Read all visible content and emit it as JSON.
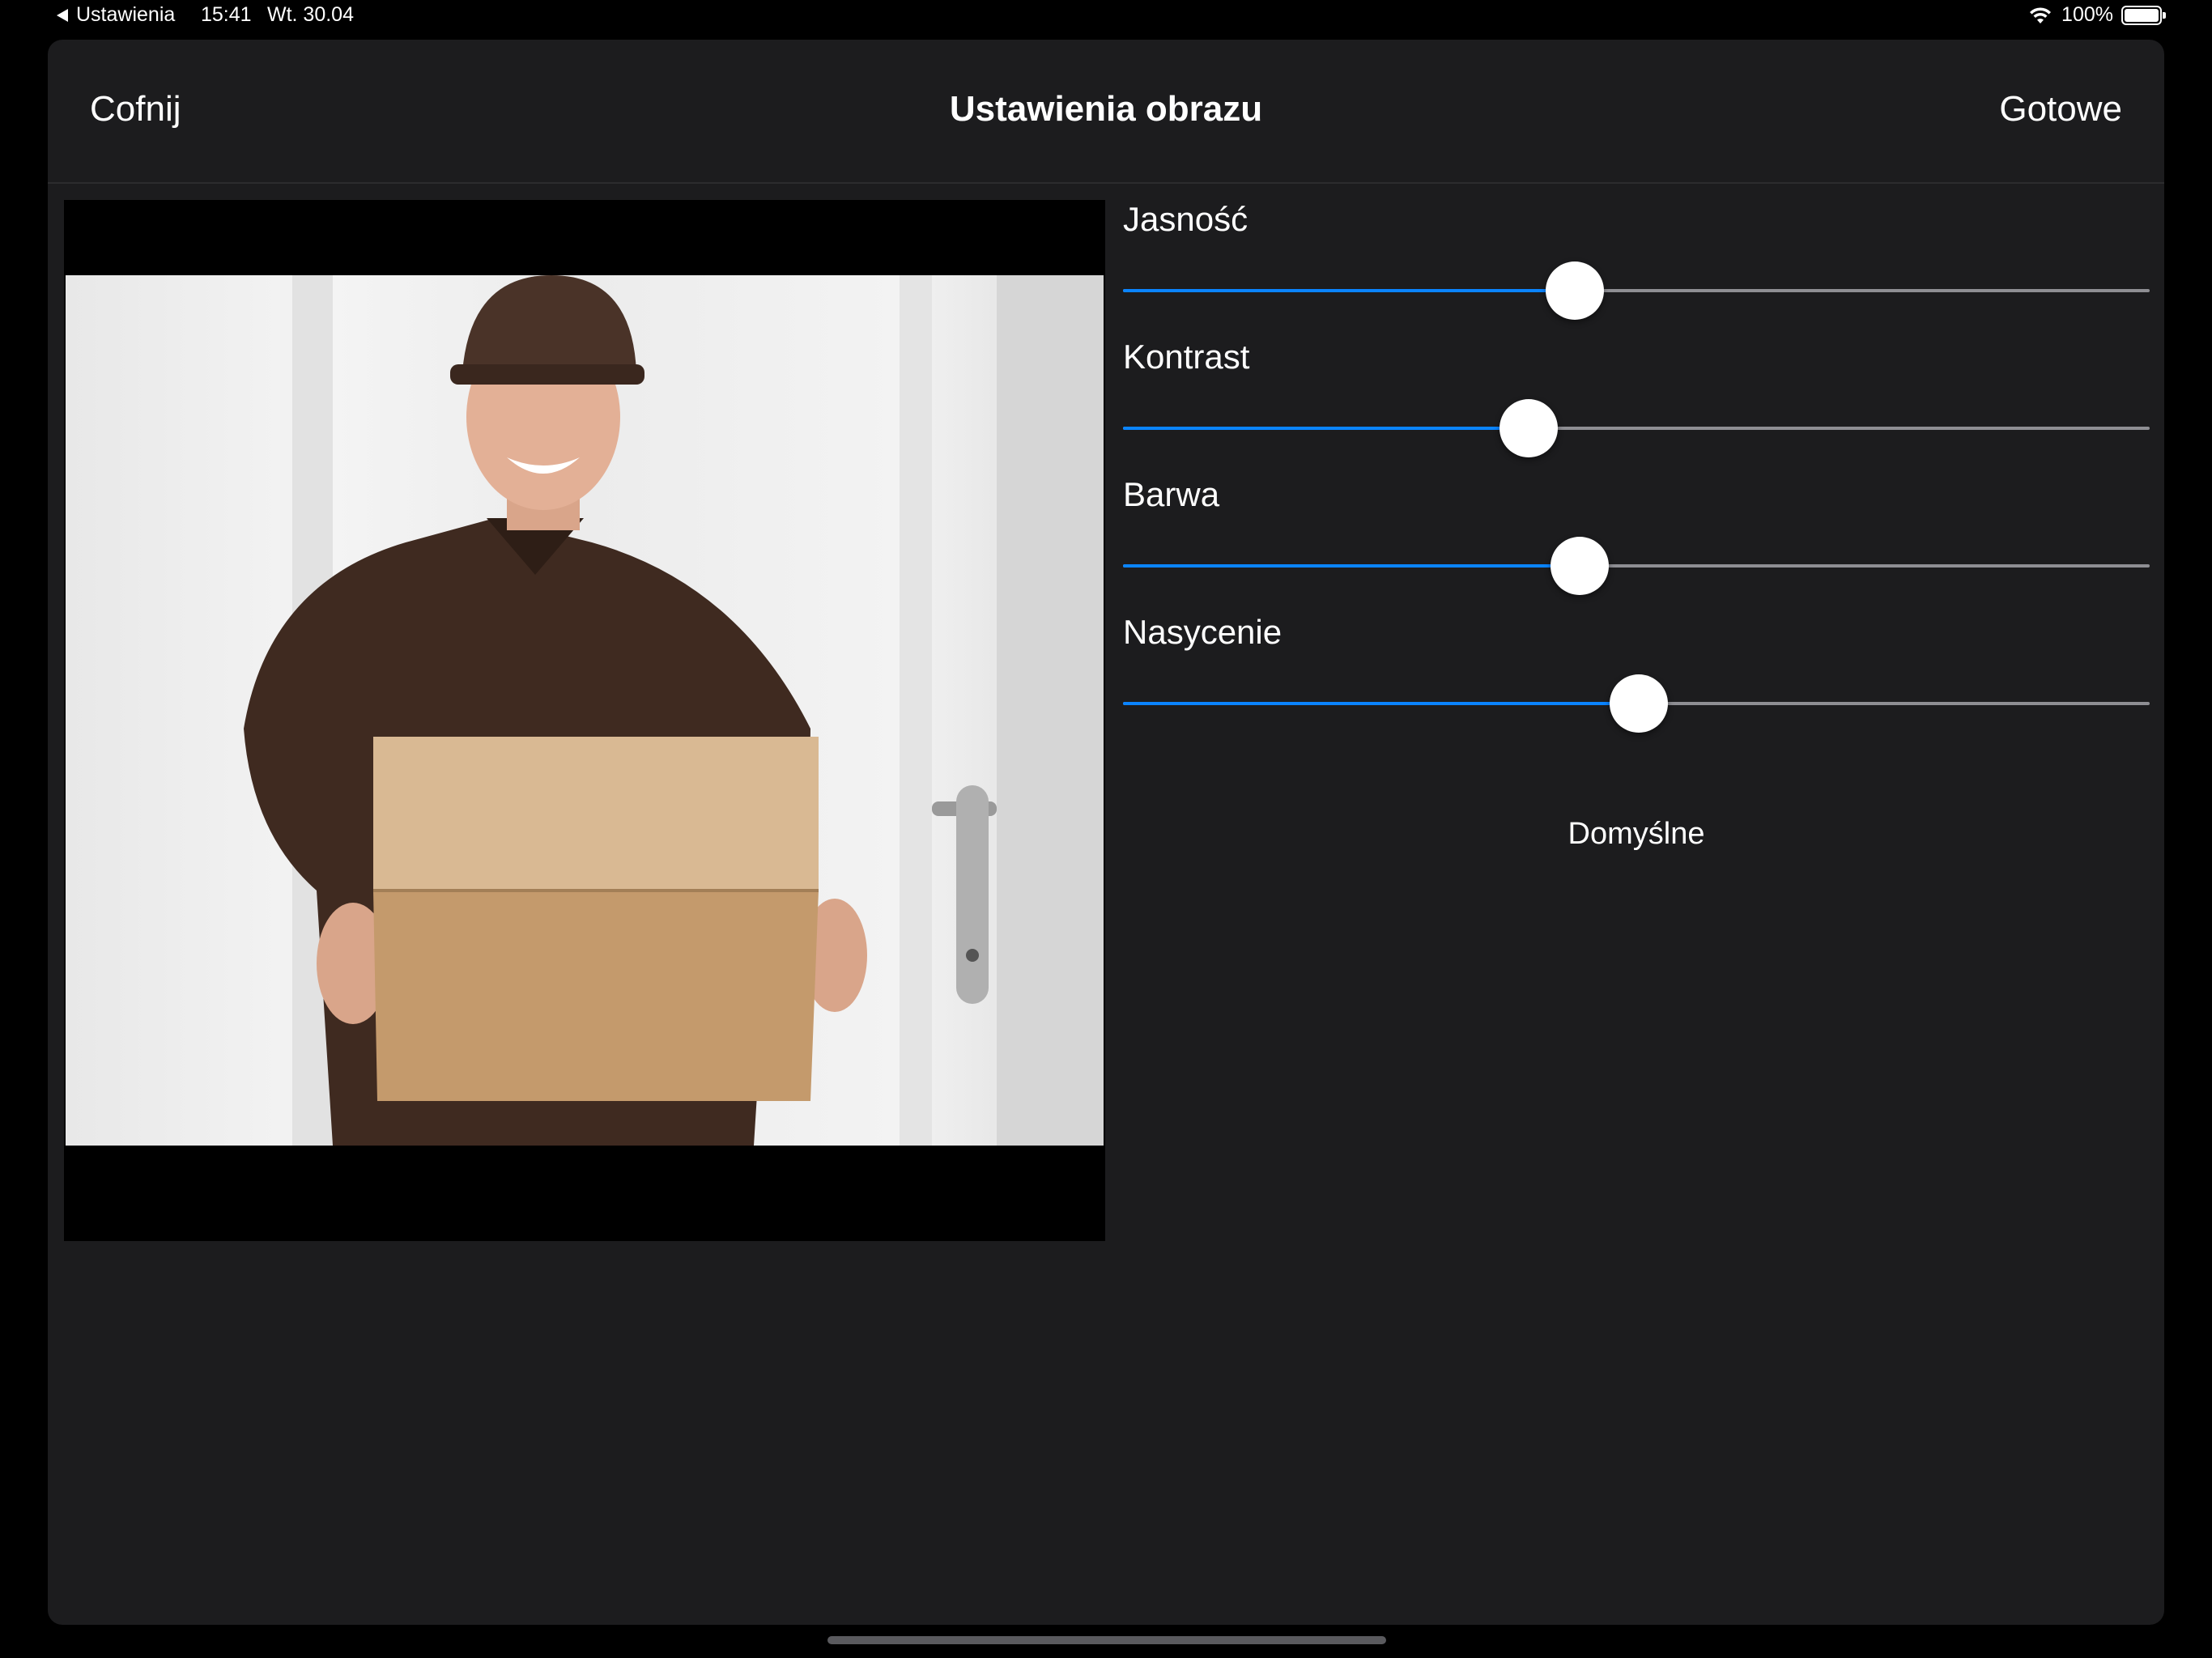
{
  "status_bar": {
    "back_label": "Ustawienia",
    "time": "15:41",
    "date": "Wt. 30.04",
    "battery": "100%",
    "battery_level": 1.0,
    "icons": [
      "back-arrow-icon",
      "wifi-icon",
      "battery-icon"
    ]
  },
  "nav": {
    "back_label": "Cofnij",
    "title": "Ustawienia obrazu",
    "done_label": "Gotowe"
  },
  "preview": {
    "image": "camera-preview-image"
  },
  "sliders": [
    {
      "key": "brightness",
      "label": "Jasność",
      "value": 0.44
    },
    {
      "key": "contrast",
      "label": "Kontrast",
      "value": 0.395
    },
    {
      "key": "hue",
      "label": "Barwa",
      "value": 0.445
    },
    {
      "key": "saturation",
      "label": "Nasycenie",
      "value": 0.502
    }
  ],
  "default_button": "Domyślne",
  "colors": {
    "accent": "#0a84ff",
    "sheet_background": "#1c1c1e",
    "track": "#8e8e93",
    "text": "#ffffff"
  }
}
